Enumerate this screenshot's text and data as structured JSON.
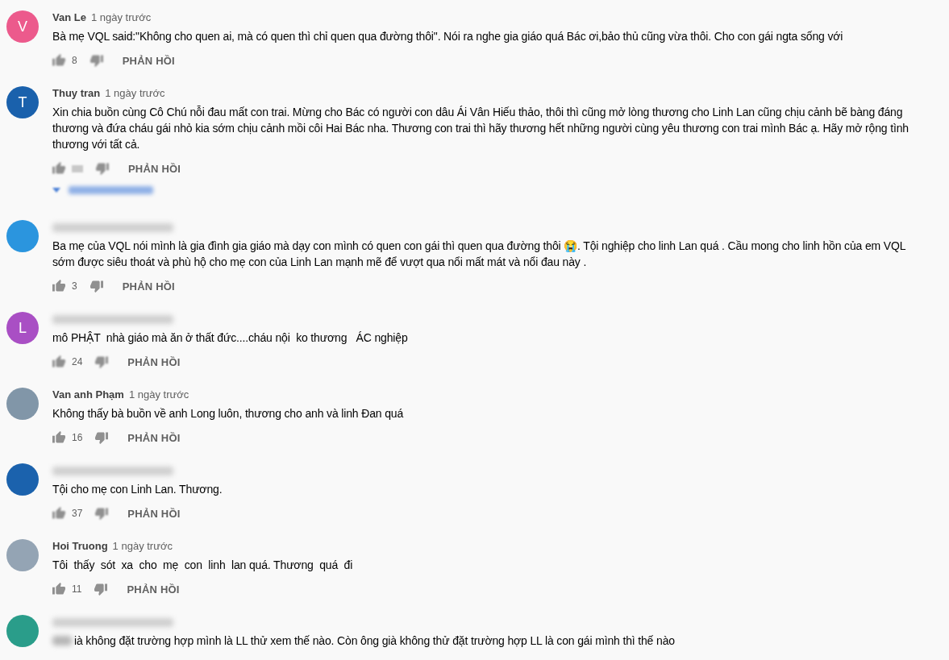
{
  "comments": [
    {
      "avatar": {
        "color": "#ec5a8c",
        "letter": "V"
      },
      "author": "Van Le",
      "time": "1 ngày trước",
      "text": "Bà mẹ VQL said:\"Không cho quen ai, mà có quen thì chỉ quen qua đường thôi\". Nói ra nghe gia giáo quá Bác ơi,bảo thủ cũng vừa thôi. Cho con gái ngta sống với",
      "likes": "8",
      "actions_blurred": true,
      "reply_label": "PHẢN HỒI"
    },
    {
      "avatar": {
        "color": "#1a61ac",
        "letter": "T"
      },
      "author": "Thuy tran",
      "time": "1 ngày trước",
      "text": "Xin chia buồn cùng Cô Chú nỗi đau mất con trai. Mừng cho Bác có người con dâu Ái Vân Hiếu thảo, thôi thì cũng mở lòng thương cho Linh Lan cũng chịu cảnh bẽ bàng đáng thương và đứa cháu gái nhỏ kia sớm chịu cảnh mồi côi Hai Bác nha. Thương con trai thì hãy thương hết những người cùng yêu thương con trai mình Bác ạ. Hãy mở rộng tình thương với tất cả.",
      "actions_blurred": true,
      "reply_label": "PHẢN HỒI",
      "replies_link_redacted": true
    },
    {
      "avatar": {
        "color": "#2b95de"
      },
      "text": "Ba mẹ của VQL nói mình là gia đình gia giáo mà dạy con mình có quen con gái thì quen qua đường thôi 😭. Tội nghiệp cho linh Lan quá . Cầu mong cho linh hồn của em VQL sớm được siêu thoát và phù hộ cho mẹ con của Linh Lan mạnh mẽ để vượt qua nổi mất mát và nổi đau này .",
      "likes": "3",
      "actions_blurred": false,
      "reply_label": "PHẢN HỒI"
    },
    {
      "avatar": {
        "color": "#a94fc4",
        "letter": "L"
      },
      "text": "mô PHẬT  nhà giáo mà ăn ở thất đức....cháu nội  ko thương   ÁC nghiệp",
      "likes": "24",
      "actions_blurred": true,
      "reply_label": "PHẢN HỒI"
    },
    {
      "avatar": {
        "color": "#8196a8"
      },
      "author": "Van anh Phạm",
      "time": "1 ngày trước",
      "text": "Không thấy bà buồn về anh Long luôn, thương cho anh và linh Đan quá",
      "likes": "16",
      "actions_blurred": false,
      "reply_label": "PHẢN HỒI"
    },
    {
      "avatar": {
        "color": "#1b62ad"
      },
      "text": "Tội cho mẹ con Linh Lan. Thương.",
      "likes": "37",
      "actions_blurred": true,
      "reply_label": "PHẢN HỒI"
    },
    {
      "avatar": {
        "color": "#94a4b4"
      },
      "author": "Hoi Truong",
      "time": "1 ngày trước",
      "text": "Tôi  thấy  sót  xa  cho  mẹ  con  linh  lan quá. Thương  quá  đi",
      "likes": "11",
      "actions_blurred": false,
      "reply_label": "PHẢN HỒI"
    },
    {
      "avatar": {
        "color": "#2a9d8a"
      },
      "lead_redacted": true,
      "text": "ià không đặt trường hợp mình là LL thử xem thế nào. Còn ông già không thử đặt trường hợp LL là con gái mình thì thế nào"
    }
  ]
}
